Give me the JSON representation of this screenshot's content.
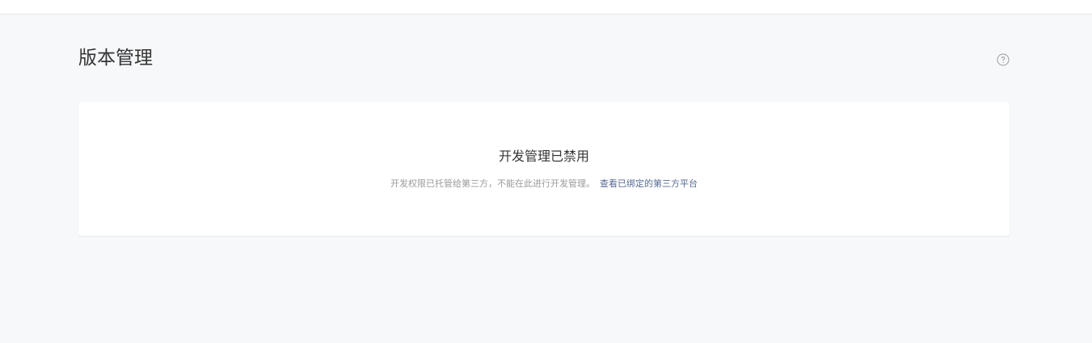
{
  "header": {
    "title": "版本管理",
    "help_icon": "question-circle-icon"
  },
  "notice": {
    "title": "开发管理已禁用",
    "description": "开发权限已托管给第三方，不能在此进行开发管理。",
    "link_label": "查看已绑定的第三方平台"
  },
  "colors": {
    "background": "#f7f8fa",
    "card": "#ffffff",
    "link": "#576b95",
    "muted_text": "#9a9a9a",
    "title_text": "#353535"
  }
}
